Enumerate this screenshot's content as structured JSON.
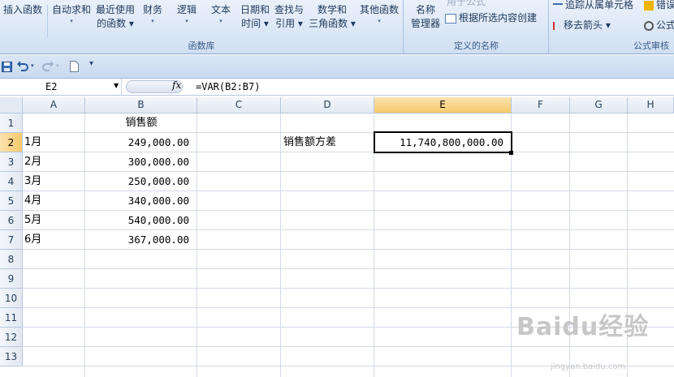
{
  "ribbon": {
    "buttons": [
      {
        "label": "插入函数",
        "sub": ""
      },
      {
        "label": "自动求和",
        "sub": "▾"
      },
      {
        "label": "最近使用",
        "sub": "的函数 ▾"
      },
      {
        "label": "财务",
        "sub": "▾"
      },
      {
        "label": "逻辑",
        "sub": "▾"
      },
      {
        "label": "文本",
        "sub": "▾"
      },
      {
        "label": "日期和",
        "sub": "时间 ▾"
      },
      {
        "label": "查找与",
        "sub": "引用 ▾"
      },
      {
        "label": "数学和",
        "sub": "三角函数 ▾"
      },
      {
        "label": "其他函数",
        "sub": "▾"
      }
    ],
    "group_function_library": "函数库",
    "name_manager_line1": "名称",
    "name_manager_line2": "管理器",
    "use_in_formula": "用于公式",
    "create_from_selection": "根据所选内容创建",
    "group_defined_names": "定义的名称",
    "trace_dependents": "追踪从属单元格",
    "remove_arrows": "移去箭头 ▾",
    "error_check": "错误",
    "formula_eval": "公式",
    "group_formula_auditing": "公式审核"
  },
  "qat": {
    "save_icon": "save-icon",
    "undo_icon": "undo-icon",
    "redo_icon": "redo-icon",
    "new_icon": "new-document-icon",
    "customize": "▾"
  },
  "formula_bar": {
    "name_box": "E2",
    "fx": "fx",
    "formula": "=VAR(B2:B7)"
  },
  "columns": [
    "A",
    "B",
    "C",
    "D",
    "E",
    "F",
    "G",
    "H"
  ],
  "rows": [
    "1",
    "2",
    "3",
    "4",
    "5",
    "6",
    "7",
    "8",
    "9",
    "10",
    "11",
    "12",
    "13"
  ],
  "cells": {
    "B1": "销售额",
    "A2": "1月",
    "B2": "249,000.00",
    "A3": "2月",
    "B3": "300,000.00",
    "A4": "3月",
    "B4": "250,000.00",
    "A5": "4月",
    "B5": "340,000.00",
    "A6": "5月",
    "B6": "540,000.00",
    "A7": "6月",
    "B7": "367,000.00",
    "D2": "销售额方差",
    "E2": "11,740,800,000.00"
  },
  "selection": {
    "cell": "E2",
    "highlight_color": "#f7c96b"
  },
  "watermark": {
    "brand": "Baidu经验",
    "url": "jingyan.baidu.com"
  }
}
